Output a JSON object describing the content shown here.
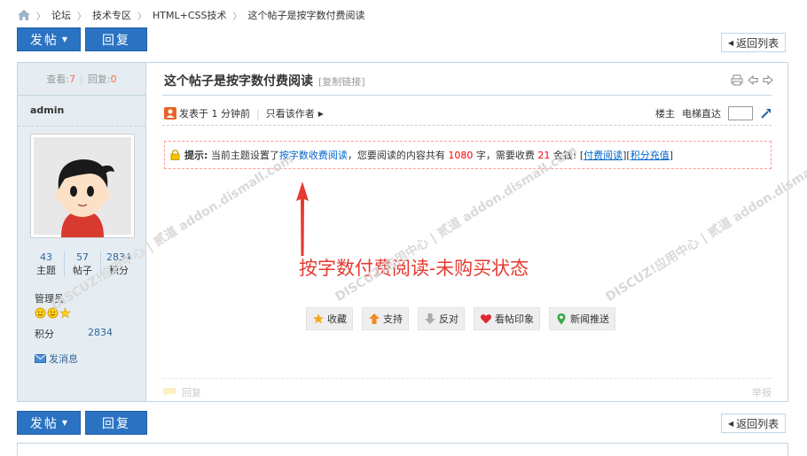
{
  "breadcrumb": {
    "items": [
      "论坛",
      "技术专区",
      "HTML+CSS技术",
      "这个帖子是按字数付费阅读"
    ],
    "sep": "〉"
  },
  "toolbar": {
    "post_label": "发帖",
    "reply_label": "回复",
    "back_label": "返回列表"
  },
  "sidebar": {
    "views_label": "查看:",
    "views_value": "7",
    "replies_label": "回复:",
    "replies_value": "0",
    "author": "admin",
    "stats": [
      {
        "value": "43",
        "label": "主题"
      },
      {
        "value": "57",
        "label": "帖子"
      },
      {
        "value": "2834",
        "label": "积分"
      }
    ],
    "group": "管理员",
    "points_label": "积分",
    "points_value": "2834",
    "message_label": "发消息"
  },
  "post": {
    "title": "这个帖子是按字数付费阅读",
    "copy_link": "[复制链接]",
    "posted": "发表于 1 分钟前",
    "only_author": "只看该作者",
    "floor_label": "楼主",
    "jump_label": "电梯直达",
    "notice": {
      "prefix": "提示:",
      "text1": "当前主题设置了",
      "mode": "按字数收费阅读",
      "text2": "，您要阅读的内容共有",
      "count": "1080",
      "text3": "字，需要收费",
      "price": "21",
      "text4": "金钱!",
      "pay_link": "付费阅读",
      "recharge_link": "积分充值"
    },
    "annotation": "按字数付费阅读-未购买状态",
    "actions": [
      {
        "icon": "star-icon",
        "label": "收藏",
        "color": "#f5a623"
      },
      {
        "icon": "arrow-up-icon",
        "label": "支持",
        "color": "#f08a24"
      },
      {
        "icon": "arrow-down-icon",
        "label": "反对",
        "color": "#aaaaaa"
      },
      {
        "icon": "heart-icon",
        "label": "看帖印象",
        "color": "#e0282e"
      },
      {
        "icon": "pin-icon",
        "label": "新闻推送",
        "color": "#3aa84a"
      }
    ],
    "reply_label": "回复",
    "report_label": "举报"
  },
  "watermark": "DISCUZ!应用中心 | 贰道 addon.dismall.com",
  "colors": {
    "accent": "#2b73c2",
    "border": "#c2d5e3",
    "sidebar_bg": "#e5edf2",
    "annotation": "#e43a2f"
  }
}
